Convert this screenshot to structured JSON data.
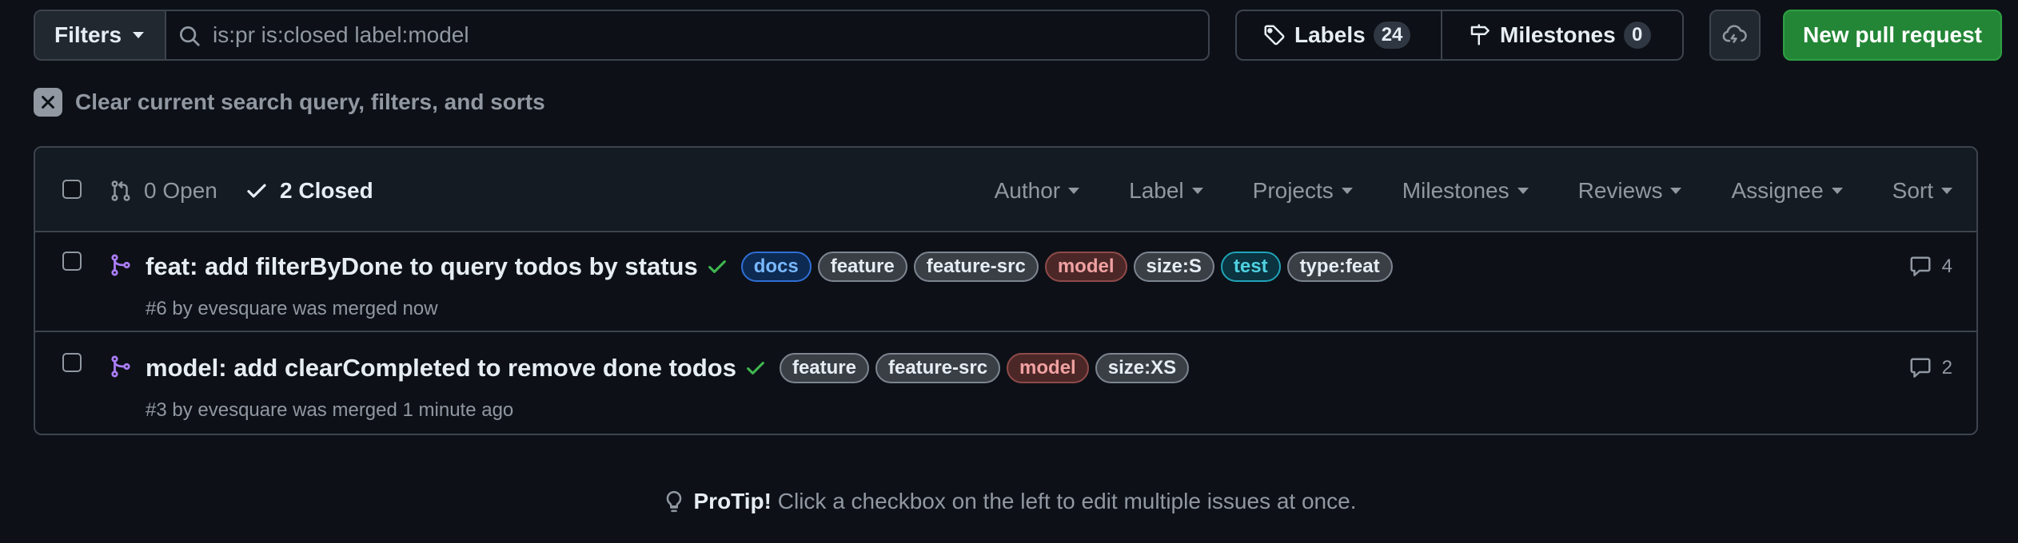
{
  "toolbar": {
    "filters_label": "Filters",
    "search_value": "is:pr is:closed label:model",
    "labels_label": "Labels",
    "labels_count": "24",
    "milestones_label": "Milestones",
    "milestones_count": "0",
    "new_pr_label": "New pull request"
  },
  "clear_query": {
    "label": "Clear current search query, filters, and sorts"
  },
  "list_header": {
    "open_label": "0 Open",
    "closed_label": "2 Closed",
    "filters": {
      "author": "Author",
      "label": "Label",
      "projects": "Projects",
      "milestones": "Milestones",
      "reviews": "Reviews",
      "assignee": "Assignee",
      "sort": "Sort"
    }
  },
  "pull_requests": [
    {
      "title": "feat: add filterByDone to query todos by status",
      "meta": "#6 by evesquare was merged now",
      "comments": "4",
      "labels": [
        {
          "name": "docs"
        },
        {
          "name": "feature"
        },
        {
          "name": "feature-src"
        },
        {
          "name": "model"
        },
        {
          "name": "size:S"
        },
        {
          "name": "test"
        },
        {
          "name": "type:feat"
        }
      ]
    },
    {
      "title": "model: add clearCompleted to remove done todos",
      "meta": "#3 by evesquare was merged 1 minute ago",
      "comments": "2",
      "labels": [
        {
          "name": "feature"
        },
        {
          "name": "feature-src"
        },
        {
          "name": "model"
        },
        {
          "name": "size:XS"
        }
      ]
    }
  ],
  "protip": {
    "lead": "ProTip!",
    "text": " Click a checkbox on the left to edit multiple issues at once."
  },
  "colors": {
    "background": "#0d1117",
    "merged_purple": "#ab7df8",
    "success_green": "#3fb950",
    "primary_button": "#238636"
  }
}
